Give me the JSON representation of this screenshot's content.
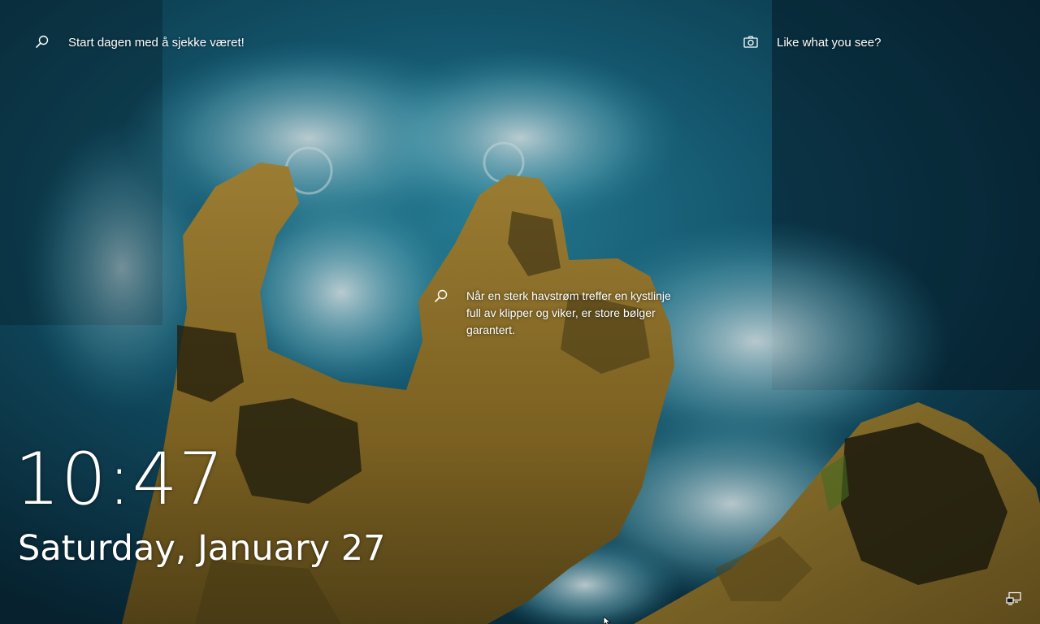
{
  "lockscreen": {
    "top_left": {
      "icon": "search-icon",
      "label": "Start dagen med å sjekke været!"
    },
    "top_right": {
      "icon": "camera-icon",
      "label": "Like what you see?"
    },
    "spotlight_fact": {
      "icon": "search-icon",
      "text": "Når en sterk havstrøm treffer en kystlinje full av klipper og viker, er store bølger garantert."
    },
    "time": "10:47",
    "date": "Saturday, January 27",
    "status_icons": [
      "network-icon"
    ]
  },
  "colors": {
    "ocean_deep": "#0a2c3c",
    "ocean_mid": "#1d6b84",
    "surf": "#cfe7ee",
    "rock": "#9a7a2c",
    "rock_dark": "#3a3418",
    "text": "#ffffff"
  }
}
